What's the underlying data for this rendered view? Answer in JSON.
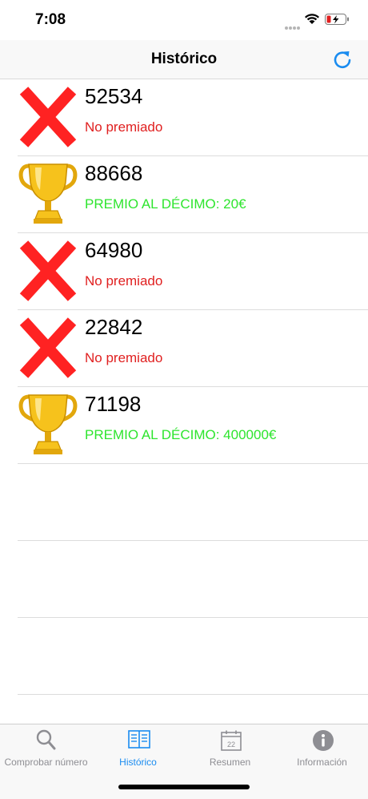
{
  "status_bar": {
    "time": "7:08"
  },
  "nav": {
    "title": "Histórico"
  },
  "colors": {
    "loss": "#e02020",
    "win": "#2ee52e",
    "accent": "#1a8cf0"
  },
  "entries": [
    {
      "number": "52534",
      "status": "No premiado",
      "result": "loss",
      "icon": "red-x-icon"
    },
    {
      "number": "88668",
      "status": "PREMIO AL DÉCIMO: 20€",
      "result": "win",
      "icon": "trophy-icon"
    },
    {
      "number": "64980",
      "status": "No premiado",
      "result": "loss",
      "icon": "red-x-icon"
    },
    {
      "number": "22842",
      "status": "No premiado",
      "result": "loss",
      "icon": "red-x-icon"
    },
    {
      "number": "71198",
      "status": "PREMIO AL DÉCIMO: 400000€",
      "result": "win",
      "icon": "trophy-icon"
    }
  ],
  "tabs": [
    {
      "label": "Comprobar número",
      "icon": "magnifier-icon",
      "active": false
    },
    {
      "label": "Histórico",
      "icon": "book-icon",
      "active": true
    },
    {
      "label": "Resumen",
      "icon": "calendar-icon",
      "calendar_day": "22",
      "active": false
    },
    {
      "label": "Información",
      "icon": "info-icon",
      "active": false
    }
  ]
}
